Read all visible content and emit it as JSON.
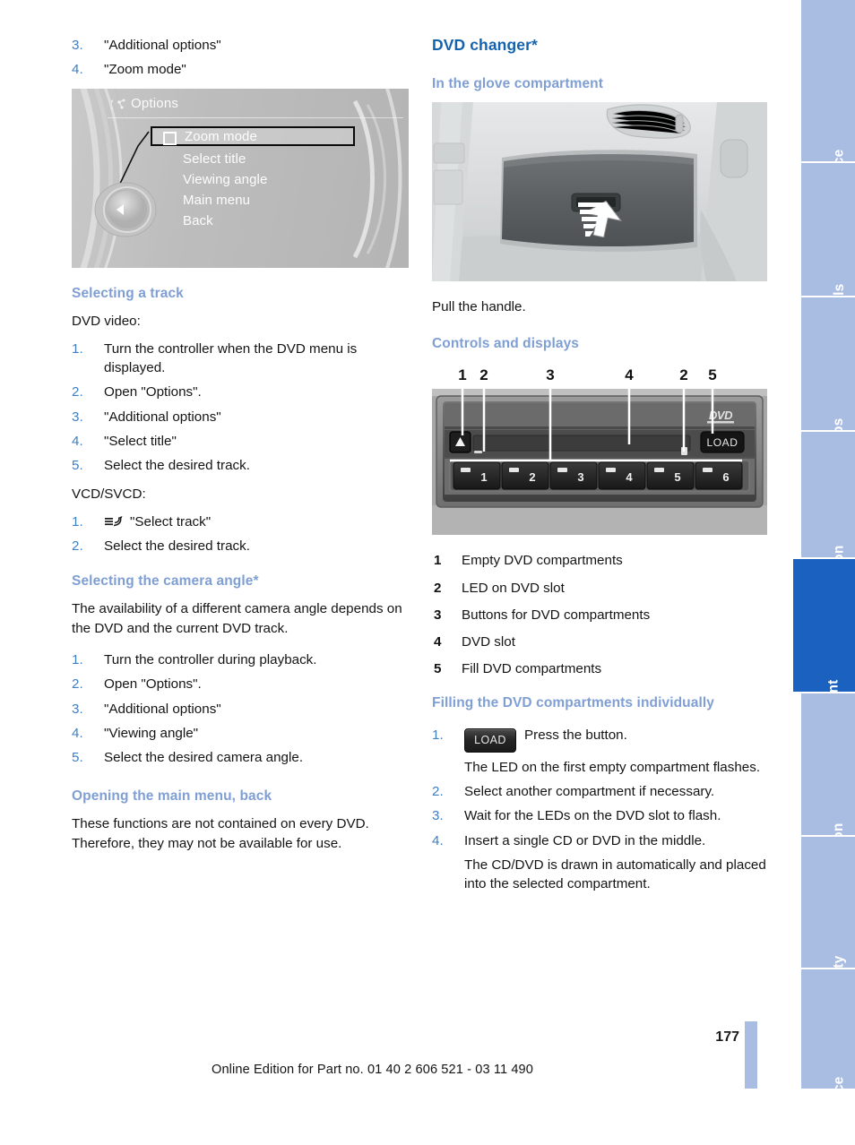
{
  "left_column": {
    "top_steps": [
      {
        "num": "3.",
        "text": "\"Additional options\""
      },
      {
        "num": "4.",
        "text": "\"Zoom mode\""
      }
    ],
    "idrive_figure": {
      "name": "idrive-options-menu",
      "title": "Options",
      "title_icon": "options-menu-icon",
      "menu_items": [
        {
          "label": "Zoom mode",
          "selected": true,
          "checkbox": true
        },
        {
          "label": "Select title",
          "selected": false,
          "checkbox": false
        },
        {
          "label": "Viewing angle",
          "selected": false,
          "checkbox": false
        },
        {
          "label": "Main menu",
          "selected": false,
          "checkbox": false
        },
        {
          "label": "Back",
          "selected": false,
          "checkbox": false
        }
      ]
    },
    "section_track": {
      "heading": "Selecting a track",
      "intro_dvd": "DVD video:",
      "dvd_steps": [
        {
          "num": "1.",
          "text": "Turn the controller when the DVD menu is displayed."
        },
        {
          "num": "2.",
          "text": "Open \"Options\"."
        },
        {
          "num": "3.",
          "text": "\"Additional options\""
        },
        {
          "num": "4.",
          "text": "\"Select title\""
        },
        {
          "num": "5.",
          "text": "Select the desired track."
        }
      ],
      "intro_vcd": "VCD/SVCD:",
      "vcd_steps": [
        {
          "num": "1.",
          "icon": "voice-command-icon",
          "text": "\"Select track\""
        },
        {
          "num": "2.",
          "icon": null,
          "text": "Select the desired track."
        }
      ]
    },
    "section_camera": {
      "heading": "Selecting the camera angle*",
      "body": "The availability of a different camera angle depends on the DVD and the current DVD track.",
      "steps": [
        {
          "num": "1.",
          "text": "Turn the controller during playback."
        },
        {
          "num": "2.",
          "text": "Open \"Options\"."
        },
        {
          "num": "3.",
          "text": "\"Additional options\""
        },
        {
          "num": "4.",
          "text": "\"Viewing angle\""
        },
        {
          "num": "5.",
          "text": "Select the desired camera angle."
        }
      ]
    },
    "section_mainmenu": {
      "heading": "Opening the main menu, back",
      "body": "These functions are not contained on every DVD. Therefore, they may not be available for use."
    }
  },
  "right_column": {
    "title": "DVD changer*",
    "section_glove": {
      "heading": "In the glove compartment",
      "figure_name": "glove-compartment-photo",
      "caption": "Pull the handle."
    },
    "section_controls": {
      "heading": "Controls and displays",
      "figure_name": "dvd-changer-controls-photo",
      "callouts": [
        "1",
        "2",
        "3",
        "4",
        "2",
        "5"
      ],
      "slot_buttons": [
        "1",
        "2",
        "3",
        "4",
        "5",
        "6"
      ],
      "load_button_label": "LOAD",
      "dvd_logo": "DVD",
      "legend": [
        {
          "num": "1",
          "text": "Empty DVD compartments"
        },
        {
          "num": "2",
          "text": "LED on DVD slot"
        },
        {
          "num": "3",
          "text": "Buttons for DVD compartments"
        },
        {
          "num": "4",
          "text": "DVD slot"
        },
        {
          "num": "5",
          "text": "Fill DVD compartments"
        }
      ]
    },
    "section_filling": {
      "heading": "Filling the DVD compartments individually",
      "steps": [
        {
          "num": "1.",
          "chip": "LOAD",
          "text": "Press the button.",
          "sub": "The LED on the first empty compartment flashes."
        },
        {
          "num": "2.",
          "chip": null,
          "text": "Select another compartment if necessary.",
          "sub": null
        },
        {
          "num": "3.",
          "chip": null,
          "text": "Wait for the LEDs on the DVD slot to flash.",
          "sub": null
        },
        {
          "num": "4.",
          "chip": null,
          "text": "Insert a single CD or DVD in the middle.",
          "sub": "The CD/DVD is drawn in automatically and placed into the selected compartment."
        }
      ]
    }
  },
  "sidebar": {
    "tabs": [
      {
        "label": "At a glance",
        "active": false
      },
      {
        "label": "Controls",
        "active": false
      },
      {
        "label": "Driving tips",
        "active": false
      },
      {
        "label": "Navigation",
        "active": false
      },
      {
        "label": "Entertainment",
        "active": true
      },
      {
        "label": "Communication",
        "active": false
      },
      {
        "label": "Mobility",
        "active": false
      },
      {
        "label": "Reference",
        "active": false
      }
    ]
  },
  "footer": {
    "page_number": "177",
    "edition": "Online Edition for Part no. 01 40 2 606 521 - 03 11 490"
  },
  "colors": {
    "heading_primary": "#1463ad",
    "heading_secondary": "#7f9fd4",
    "step_number": "#3f7fc4",
    "tab_inactive": "#a9bde3",
    "tab_active": "#1b62c0"
  }
}
